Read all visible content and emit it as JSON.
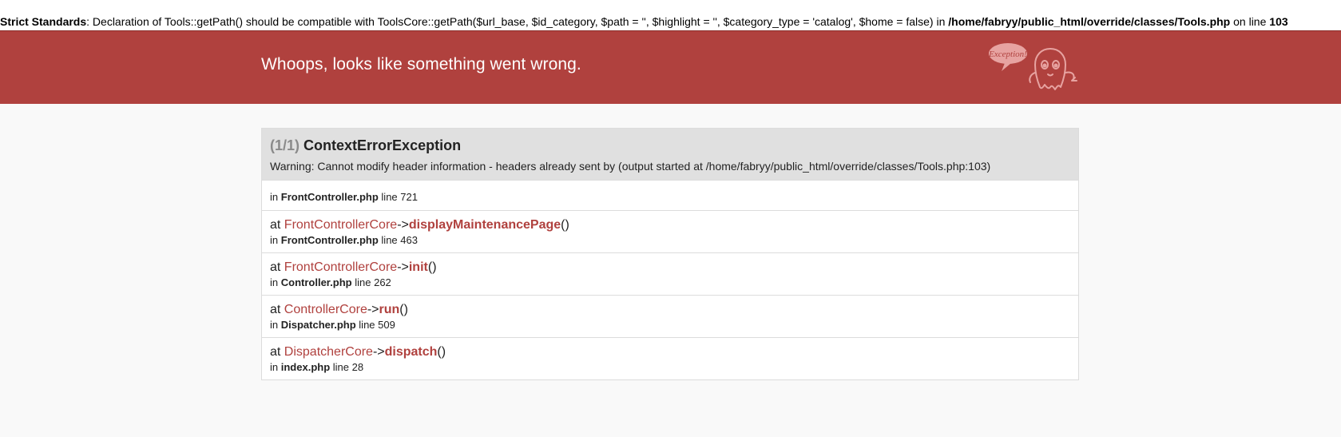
{
  "warning_bar": {
    "prefix": "Strict Standards",
    "message": ": Declaration of Tools::getPath() should be compatible with ToolsCore::getPath($url_base, $id_category, $path = '', $highlight = '', $category_type = 'catalog', $home = false) in ",
    "file": "/home/fabryy/public_html/override/classes/Tools.php",
    "on_line": " on line ",
    "line": "103"
  },
  "banner": {
    "title": "Whoops, looks like something went wrong.",
    "logo_text": "Exception!",
    "logo_icon": "ghost-icon"
  },
  "exception": {
    "count": "(1/1)",
    "name": "ContextErrorException",
    "message": "Warning: Cannot modify header information - headers already sent by (output started at /home/fabryy/public_html/override/classes/Tools.php:103)"
  },
  "trace": [
    {
      "at": "",
      "class": "",
      "arrow": "",
      "method": "",
      "parens": "",
      "in": "in",
      "file": "FrontController.php",
      "line_label": "line",
      "line": "721"
    },
    {
      "at": "at",
      "class": "FrontControllerCore",
      "arrow": "->",
      "method": "displayMaintenancePage",
      "parens": "()",
      "in": "in",
      "file": "FrontController.php",
      "line_label": "line",
      "line": "463"
    },
    {
      "at": "at",
      "class": "FrontControllerCore",
      "arrow": "->",
      "method": "init",
      "parens": "()",
      "in": "in",
      "file": "Controller.php",
      "line_label": "line",
      "line": "262"
    },
    {
      "at": "at",
      "class": "ControllerCore",
      "arrow": "->",
      "method": "run",
      "parens": "()",
      "in": "in",
      "file": "Dispatcher.php",
      "line_label": "line",
      "line": "509"
    },
    {
      "at": "at",
      "class": "DispatcherCore",
      "arrow": "->",
      "method": "dispatch",
      "parens": "()",
      "in": "in",
      "file": "index.php",
      "line_label": "line",
      "line": "28"
    }
  ],
  "colors": {
    "banner": "#b0413e",
    "accent": "#b0413e",
    "page_bg": "#f9f9f9",
    "panel_head": "#e0e0e0"
  }
}
